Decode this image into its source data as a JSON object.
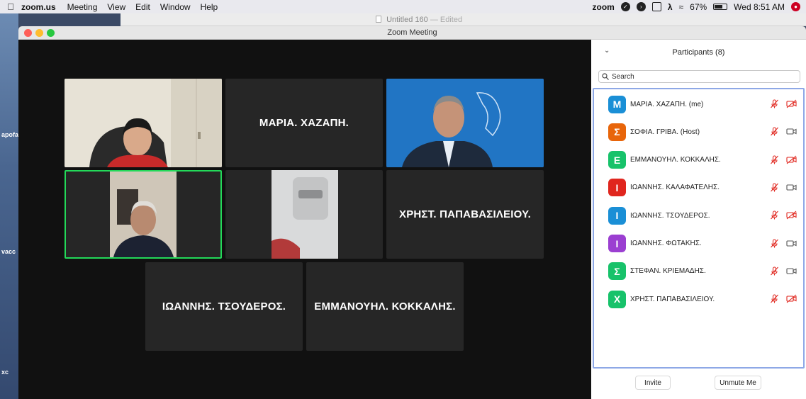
{
  "menubar": {
    "app_name": "zoom.us",
    "items": [
      "Meeting",
      "View",
      "Edit",
      "Window",
      "Help"
    ],
    "status_app": "zoom",
    "battery": "67%",
    "datetime": "Wed 8:51 AM"
  },
  "desktop": {
    "labels": [
      "apofa",
      "vacc",
      "xc"
    ]
  },
  "background_window": {
    "title": "Untitled 160",
    "status": "— Edited"
  },
  "zoom_window": {
    "title": "Zoom Meeting"
  },
  "gallery": {
    "tiles": [
      {
        "type": "video",
        "name": ""
      },
      {
        "type": "name",
        "name": "ΜΑΡΙΑ. ΧΑΖΑΠΗ."
      },
      {
        "type": "video",
        "name": ""
      },
      {
        "type": "video",
        "name": "",
        "active_speaker": true
      },
      {
        "type": "video",
        "name": ""
      },
      {
        "type": "name",
        "name": "ΧΡΗΣΤ. ΠΑΠΑΒΑΣΙΛΕΙΟΥ."
      },
      {
        "type": "name",
        "name": "ΙΩΑΝΝΗΣ. ΤΣΟΥΔΕΡΟΣ."
      },
      {
        "type": "name",
        "name": "ΕΜΜΑΝΟΥΗΛ. ΚΟΚΚΑΛΗΣ."
      }
    ]
  },
  "participants_panel": {
    "title": "Participants (8)",
    "search_placeholder": "Search",
    "participants": [
      {
        "initial": "M",
        "name": "ΜΑΡΙΑ. ΧΑΖΑΠΗ. (me)",
        "color": "#1a8fd6",
        "muted": true,
        "video_off": true
      },
      {
        "initial": "Σ",
        "name": "ΣΟΦΙΑ. ΓΡΙΒΑ. (Host)",
        "color": "#e8650a",
        "muted": true,
        "video_off": false
      },
      {
        "initial": "E",
        "name": "ΕΜΜΑΝΟΥΗΛ. ΚΟΚΚΑΛΗΣ.",
        "color": "#17c26a",
        "muted": true,
        "video_off": true
      },
      {
        "initial": "I",
        "name": "ΙΩΑΝΝΗΣ. ΚΑΛΑΦΑΤΕΛΗΣ.",
        "color": "#e0261e",
        "muted": true,
        "video_off": false
      },
      {
        "initial": "I",
        "name": "ΙΩΑΝΝΗΣ. ΤΣΟΥΔΕΡΟΣ.",
        "color": "#1a8fd6",
        "muted": true,
        "video_off": true
      },
      {
        "initial": "I",
        "name": "ΙΩΑΝΝΗΣ. ΦΩΤΑΚΗΣ.",
        "color": "#9b3fd1",
        "muted": true,
        "video_off": false
      },
      {
        "initial": "Σ",
        "name": "ΣΤΕΦΑΝ. ΚΡΙΕΜΑΔΗΣ.",
        "color": "#17c26a",
        "muted": true,
        "video_off": false
      },
      {
        "initial": "X",
        "name": "ΧΡΗΣΤ. ΠΑΠΑΒΑΣΙΛΕΙΟΥ.",
        "color": "#17c26a",
        "muted": true,
        "video_off": true
      }
    ],
    "invite_label": "Invite",
    "unmute_label": "Unmute Me"
  }
}
